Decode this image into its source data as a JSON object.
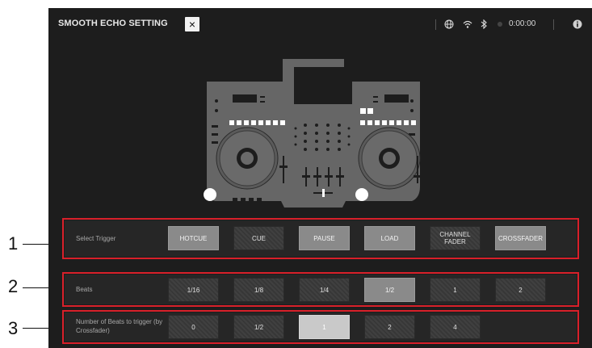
{
  "header": {
    "title": "SMOOTH ECHO SETTING",
    "close_icon": "×",
    "globe_icon": "globe-icon",
    "wifi_icon": "wifi-icon",
    "bluetooth_icon": "bluetooth-icon",
    "time": "0:00:00",
    "info_icon": "info-icon"
  },
  "rows": [
    {
      "label": "Select Trigger",
      "buttons": [
        "HOTCUE",
        "CUE",
        "PAUSE",
        "LOAD",
        "CHANNEL FADER",
        "CROSSFADER"
      ],
      "selected": [
        "HOTCUE",
        "PAUSE",
        "LOAD",
        "CROSSFADER"
      ]
    },
    {
      "label": "Beats",
      "buttons": [
        "1/16",
        "1/8",
        "1/4",
        "1/2",
        "1",
        "2"
      ],
      "selected": [
        "1/2"
      ]
    },
    {
      "label": "Number of Beats  to trigger (by Crossfader)",
      "buttons": [
        "0",
        "1/2",
        "1",
        "2",
        "4"
      ],
      "selected": [
        "1"
      ]
    }
  ],
  "callouts": [
    "1",
    "2",
    "3"
  ],
  "colors": {
    "background": "#1d1d1d",
    "highlight": "#d8202a",
    "selected": "#8a8a8a"
  }
}
